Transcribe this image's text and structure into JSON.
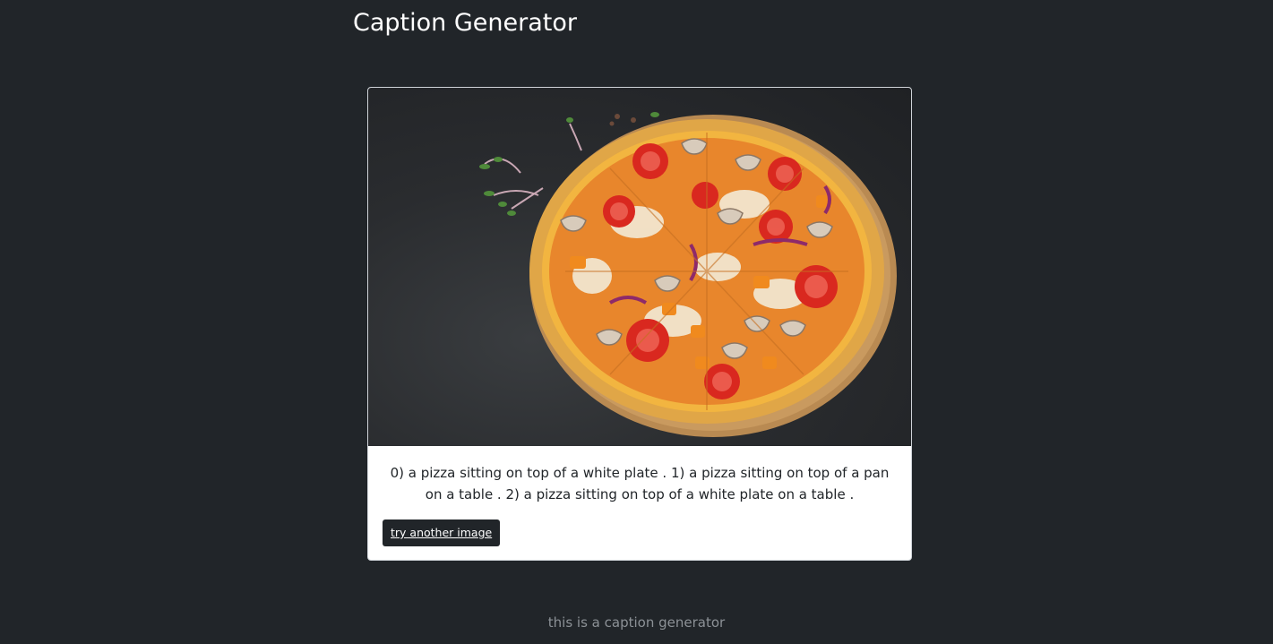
{
  "header": {
    "title": "Caption Generator"
  },
  "card": {
    "image_description": "pizza-photo",
    "caption": "0) a pizza sitting on top of a white plate . 1) a pizza sitting on top of a pan on a table . 2) a pizza sitting on top of a white plate on a table .",
    "button_label": "try another image"
  },
  "footer": {
    "text": "this is a caption generator"
  },
  "colors": {
    "background": "#212529",
    "card": "#ffffff",
    "button": "#212529",
    "footer_text": "#8c9196"
  }
}
